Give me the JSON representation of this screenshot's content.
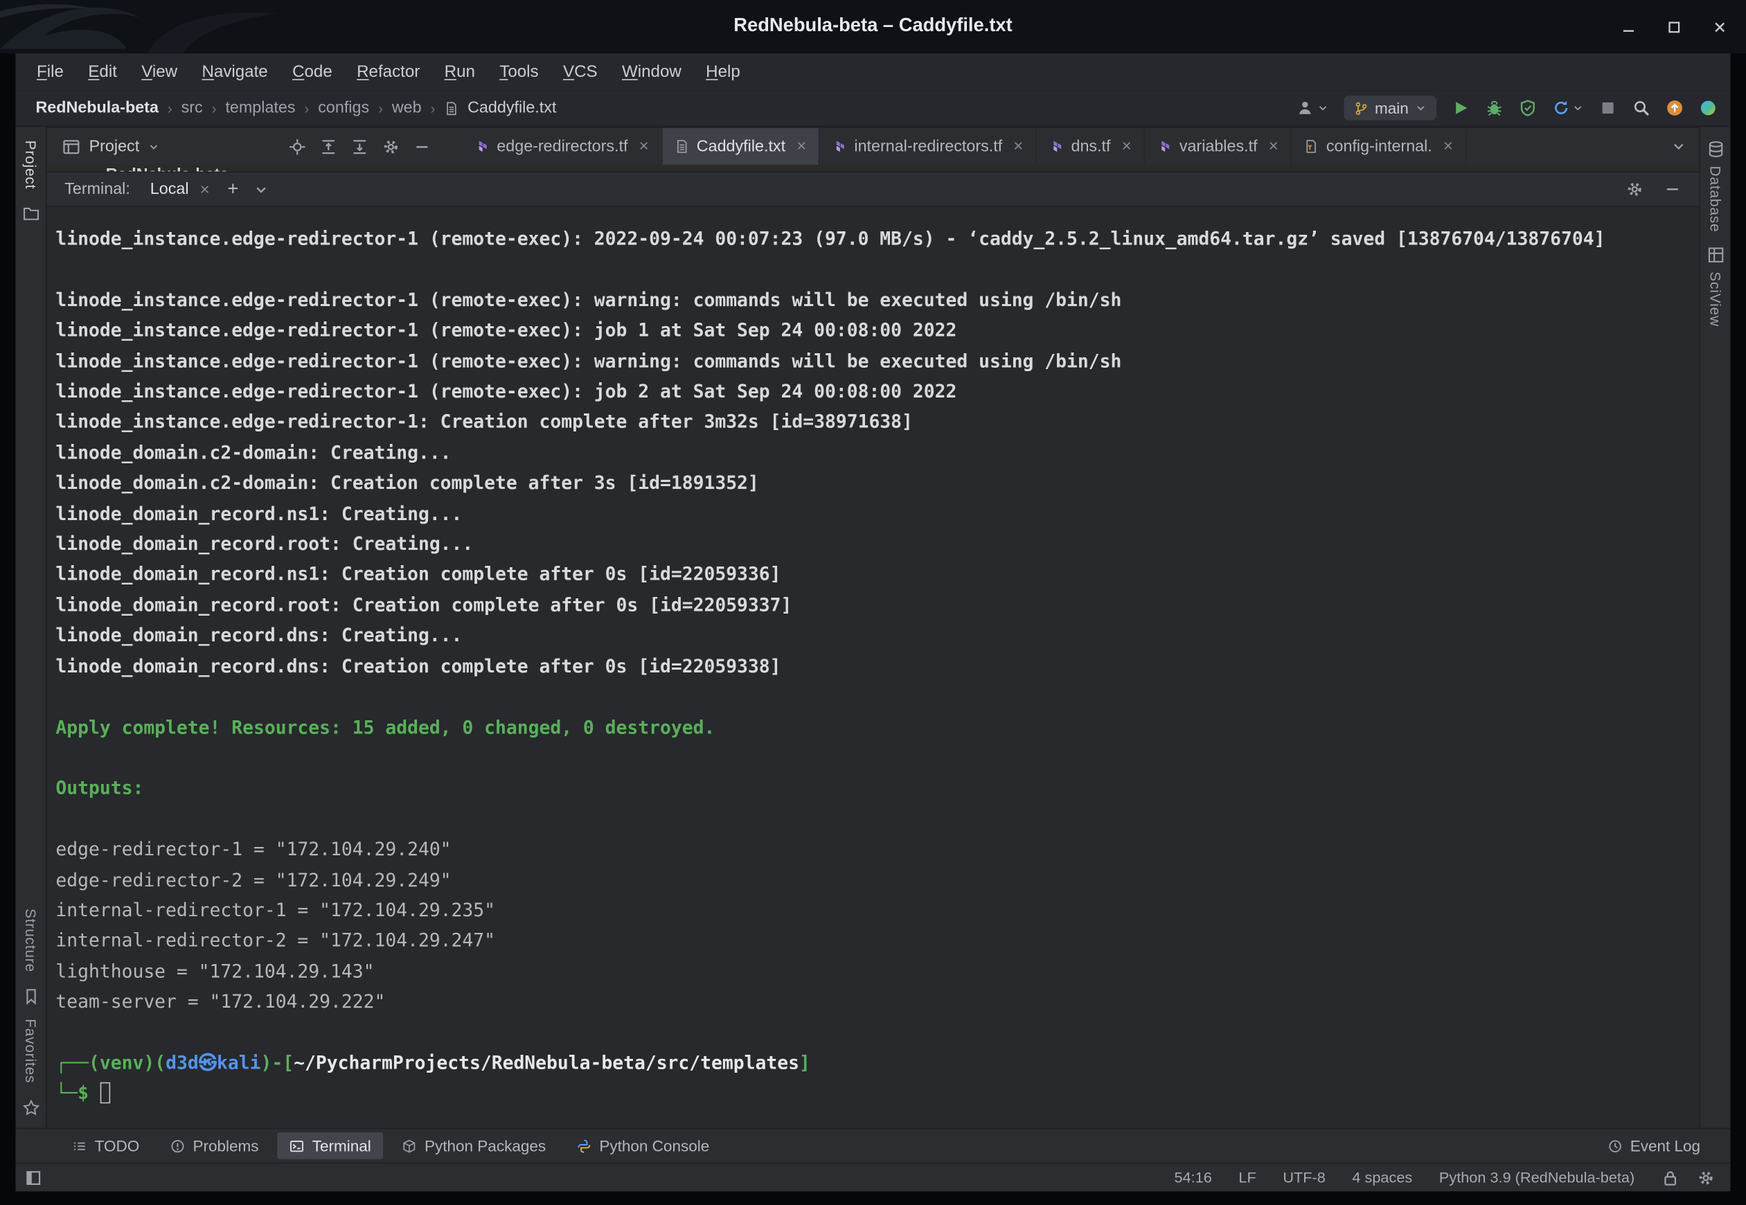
{
  "window": {
    "title": "RedNebula-beta – Caddyfile.txt"
  },
  "menu": {
    "items": [
      "File",
      "Edit",
      "View",
      "Navigate",
      "Code",
      "Refactor",
      "Run",
      "Tools",
      "VCS",
      "Window",
      "Help"
    ]
  },
  "breadcrumbs": {
    "project": "RedNebula-beta",
    "path": [
      "src",
      "templates",
      "configs",
      "web"
    ],
    "file": "Caddyfile.txt"
  },
  "run_toolbar": {
    "branch": "main"
  },
  "project_panel": {
    "title": "Project"
  },
  "editor_tabs": [
    {
      "label": "edge-redirectors.tf",
      "type": "tf",
      "active": false
    },
    {
      "label": "Caddyfile.txt",
      "type": "txt",
      "active": true
    },
    {
      "label": "internal-redirectors.tf",
      "type": "tf",
      "active": false
    },
    {
      "label": "dns.tf",
      "type": "tf",
      "active": false
    },
    {
      "label": "variables.tf",
      "type": "tf",
      "active": false
    },
    {
      "label": "config-internal.",
      "type": "yml",
      "active": false
    }
  ],
  "editor_glimpse": {
    "text": "RedNebula-beta"
  },
  "terminal": {
    "panel_label": "Terminal:",
    "tab_label": "Local",
    "lines": [
      [
        {
          "t": "linode_instance.edge-redirector-1 (remote-exec): 2022-09-24 00:07:23 (97.0 MB/s) - ‘caddy_2.5.2_linux_amd64.tar.gz’ saved [13876704/13876704]",
          "c": "b"
        }
      ],
      [],
      [
        {
          "t": "linode_instance.edge-redirector-1 (remote-exec): warning: commands will be executed using /bin/sh",
          "c": "b"
        }
      ],
      [
        {
          "t": "linode_instance.edge-redirector-1 (remote-exec): job 1 at Sat Sep 24 00:08:00 2022",
          "c": "b"
        }
      ],
      [
        {
          "t": "linode_instance.edge-redirector-1 (remote-exec): warning: commands will be executed using /bin/sh",
          "c": "b"
        }
      ],
      [
        {
          "t": "linode_instance.edge-redirector-1 (remote-exec): job 2 at Sat Sep 24 00:08:00 2022",
          "c": "b"
        }
      ],
      [
        {
          "t": "linode_instance.edge-redirector-1: Creation complete after 3m32s [id=38971638]",
          "c": "b"
        }
      ],
      [
        {
          "t": "linode_domain.c2-domain: Creating...",
          "c": "b"
        }
      ],
      [
        {
          "t": "linode_domain.c2-domain: Creation complete after 3s [id=1891352]",
          "c": "b"
        }
      ],
      [
        {
          "t": "linode_domain_record.ns1: Creating...",
          "c": "b"
        }
      ],
      [
        {
          "t": "linode_domain_record.root: Creating...",
          "c": "b"
        }
      ],
      [
        {
          "t": "linode_domain_record.ns1: Creation complete after 0s [id=22059336]",
          "c": "b"
        }
      ],
      [
        {
          "t": "linode_domain_record.root: Creation complete after 0s [id=22059337]",
          "c": "b"
        }
      ],
      [
        {
          "t": "linode_domain_record.dns: Creating...",
          "c": "b"
        }
      ],
      [
        {
          "t": "linode_domain_record.dns: Creation complete after 0s [id=22059338]",
          "c": "b"
        }
      ],
      [],
      [
        {
          "t": "Apply complete! Resources: 15 added, 0 changed, 0 destroyed.",
          "c": "g"
        }
      ],
      [],
      [
        {
          "t": "Outputs:",
          "c": "g"
        }
      ],
      [],
      [
        {
          "t": "edge-redirector-1 = \"172.104.29.240\"",
          "c": "n"
        }
      ],
      [
        {
          "t": "edge-redirector-2 = \"172.104.29.249\"",
          "c": "n"
        }
      ],
      [
        {
          "t": "internal-redirector-1 = \"172.104.29.235\"",
          "c": "n"
        }
      ],
      [
        {
          "t": "internal-redirector-2 = \"172.104.29.247\"",
          "c": "n"
        }
      ],
      [
        {
          "t": "lighthouse = \"172.104.29.143\"",
          "c": "n"
        }
      ],
      [
        {
          "t": "team-server = \"172.104.29.222\"",
          "c": "n"
        }
      ],
      [],
      [
        {
          "t": "┌──(",
          "c": "g"
        },
        {
          "t": "venv",
          "c": "g"
        },
        {
          "t": ")(",
          "c": "g"
        },
        {
          "t": "d3d㉿kali",
          "c": "u"
        },
        {
          "t": ")-[",
          "c": "g"
        },
        {
          "t": "~/PycharmProjects/RedNebula-beta/src/templates",
          "c": "w"
        },
        {
          "t": "]",
          "c": "g"
        }
      ],
      [
        {
          "t": "└─$",
          "c": "g"
        },
        {
          "t": " ",
          "c": "n"
        },
        {
          "t": "",
          "c": "cur"
        }
      ]
    ]
  },
  "tool_buttons": {
    "left": [
      {
        "label": "TODO",
        "icon": "todo",
        "active": false
      },
      {
        "label": "Problems",
        "icon": "problems",
        "active": false
      },
      {
        "label": "Terminal",
        "icon": "terminal",
        "active": true
      },
      {
        "label": "Python Packages",
        "icon": "package",
        "active": false
      },
      {
        "label": "Python Console",
        "icon": "python",
        "active": false
      }
    ],
    "right": [
      {
        "label": "Event Log",
        "icon": "clock",
        "active": false
      }
    ]
  },
  "status_bar": {
    "items": [
      "54:16",
      "LF",
      "UTF-8",
      "4 spaces",
      "Python 3.9 (RedNebula-beta)"
    ]
  },
  "left_stripe": {
    "top": [
      "Project"
    ],
    "bottom": [
      "Structure",
      "Favorites"
    ]
  },
  "right_stripe": [
    "Database",
    "SciView"
  ],
  "colors": {
    "terminal_green": "#58b158",
    "prompt_blue": "#5394ec",
    "terraform_purple": "#8c6fd0",
    "branch_yellow": "#d2a53f",
    "run_green": "#5fad65",
    "update_orange": "#d98e3d"
  }
}
